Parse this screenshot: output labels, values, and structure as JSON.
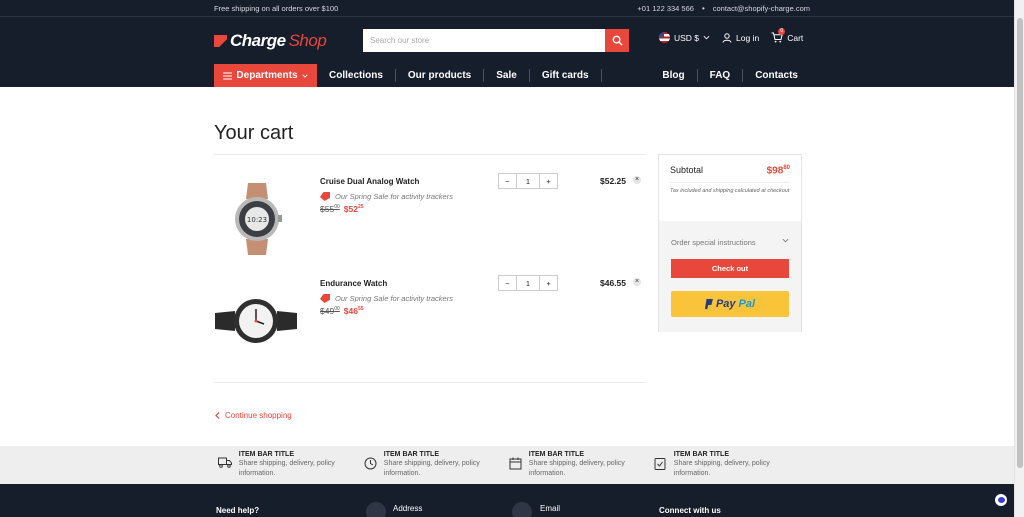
{
  "topbar": {
    "shipping": "Free shipping on all orders over $100",
    "phone": "+01 122 334 566",
    "separator": "•",
    "email": "contact@shopify-charge.com"
  },
  "header": {
    "logo_a": "Charge",
    "logo_b": "Shop",
    "search_placeholder": "Search our store",
    "currency": "USD $",
    "login": "Log in",
    "cart": "Cart",
    "cart_count": "0"
  },
  "nav": {
    "departments": "Departments",
    "left": [
      "Collections",
      "Our products",
      "Sale",
      "Gift cards"
    ],
    "right": [
      "Blog",
      "FAQ",
      "Contacts"
    ]
  },
  "page": {
    "title": "Your cart"
  },
  "cart": {
    "promo": "Our Spring Sale for activity trackers",
    "items": [
      {
        "name": "Cruise Dual Analog Watch",
        "old_main": "$55",
        "old_sup": "00",
        "new_main": "$52",
        "new_sup": "25",
        "qty": "1",
        "total": "$52.25"
      },
      {
        "name": "Endurance Watch",
        "old_main": "$49",
        "old_sup": "00",
        "new_main": "$46",
        "new_sup": "55",
        "qty": "1",
        "total": "$46.55"
      }
    ],
    "continue": "Continue shopping"
  },
  "summary": {
    "label": "Subtotal",
    "amount_main": "$98",
    "amount_sup": "80",
    "note": "Tax included and shipping calculated at checkout",
    "instructions": "Order special instructions",
    "checkout": "Check out",
    "paypal_a": "Pay",
    "paypal_b": "Pal"
  },
  "itembar": [
    {
      "title": "ITEM BAR TITLE",
      "desc": "Share shipping, delivery, policy information.",
      "icon": "truck-icon"
    },
    {
      "title": "ITEM BAR TITLE",
      "desc": "Share shipping, delivery, policy information.",
      "icon": "clock-icon"
    },
    {
      "title": "ITEM BAR TITLE",
      "desc": "Share shipping, delivery, policy information.",
      "icon": "calendar-icon"
    },
    {
      "title": "ITEM BAR TITLE",
      "desc": "Share shipping, delivery, policy information.",
      "icon": "clipboard-check-icon"
    }
  ],
  "footer": {
    "help": "Need help?",
    "address": "Address",
    "email": "Email",
    "connect": "Connect with us"
  },
  "colors": {
    "accent": "#e8473b",
    "dark": "#161d2b",
    "paypal": "#f9c43a"
  }
}
